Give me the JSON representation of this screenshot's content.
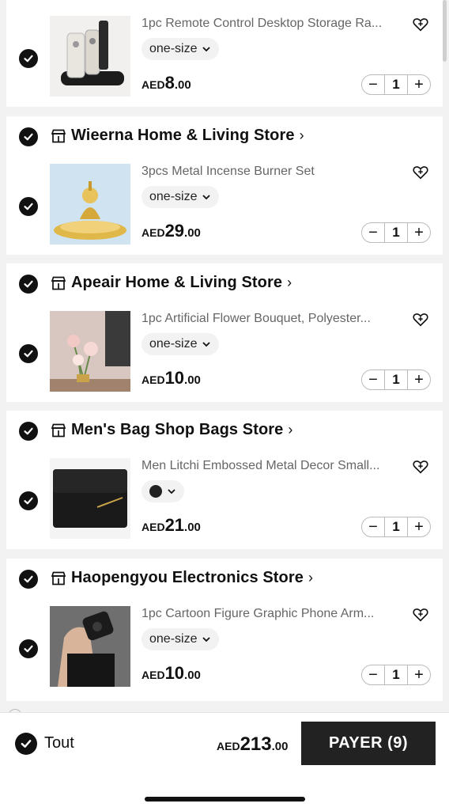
{
  "cart": {
    "stores": [
      {
        "name": "",
        "items": [
          {
            "title": "1pc Remote Control Desktop Storage Ra...",
            "variant": "one-size",
            "currency": "AED",
            "price_int": "8",
            "price_dec": ".00",
            "qty": "1",
            "image": "remote-holder"
          }
        ]
      },
      {
        "name": "Wieerna Home & Living Store",
        "items": [
          {
            "title": "3pcs Metal Incense Burner Set",
            "variant": "one-size",
            "currency": "AED",
            "price_int": "29",
            "price_dec": ".00",
            "qty": "1",
            "image": "incense-burner"
          }
        ]
      },
      {
        "name": "Apeair Home & Living Store",
        "items": [
          {
            "title": "1pc Artificial Flower Bouquet, Polyester...",
            "variant": "one-size",
            "currency": "AED",
            "price_int": "10",
            "price_dec": ".00",
            "qty": "1",
            "image": "flower-bouquet"
          }
        ]
      },
      {
        "name": "Men's Bag Shop Bags Store",
        "items": [
          {
            "title": "Men Litchi Embossed Metal Decor Small...",
            "variant": "",
            "variant_color": "#222222",
            "currency": "AED",
            "price_int": "21",
            "price_dec": ".00",
            "qty": "1",
            "image": "black-wallet"
          }
        ]
      },
      {
        "name": "Haopengyou Electronics Store",
        "items": [
          {
            "title": "1pc Cartoon Figure Graphic Phone Arm...",
            "variant": "one-size",
            "currency": "AED",
            "price_int": "10",
            "price_dec": ".00",
            "qty": "1",
            "image": "phone-armband"
          }
        ]
      }
    ]
  },
  "bottom_bar": {
    "select_all_label": "Tout",
    "total_currency": "AED",
    "total_int": "213",
    "total_dec": ".00",
    "pay_button_label": "PAYER (9)"
  },
  "icons": {
    "check": "check-circle-icon",
    "store": "store-icon",
    "wishlist": "heart-plus-icon",
    "chevron": "chevron-down-icon",
    "minus": "minus-icon",
    "plus": "plus-icon"
  },
  "qty_controls": {
    "minus": "−",
    "plus": "+"
  },
  "colors": {
    "accent": "#222222",
    "background": "#f2f2f2",
    "muted_text": "#666666"
  }
}
